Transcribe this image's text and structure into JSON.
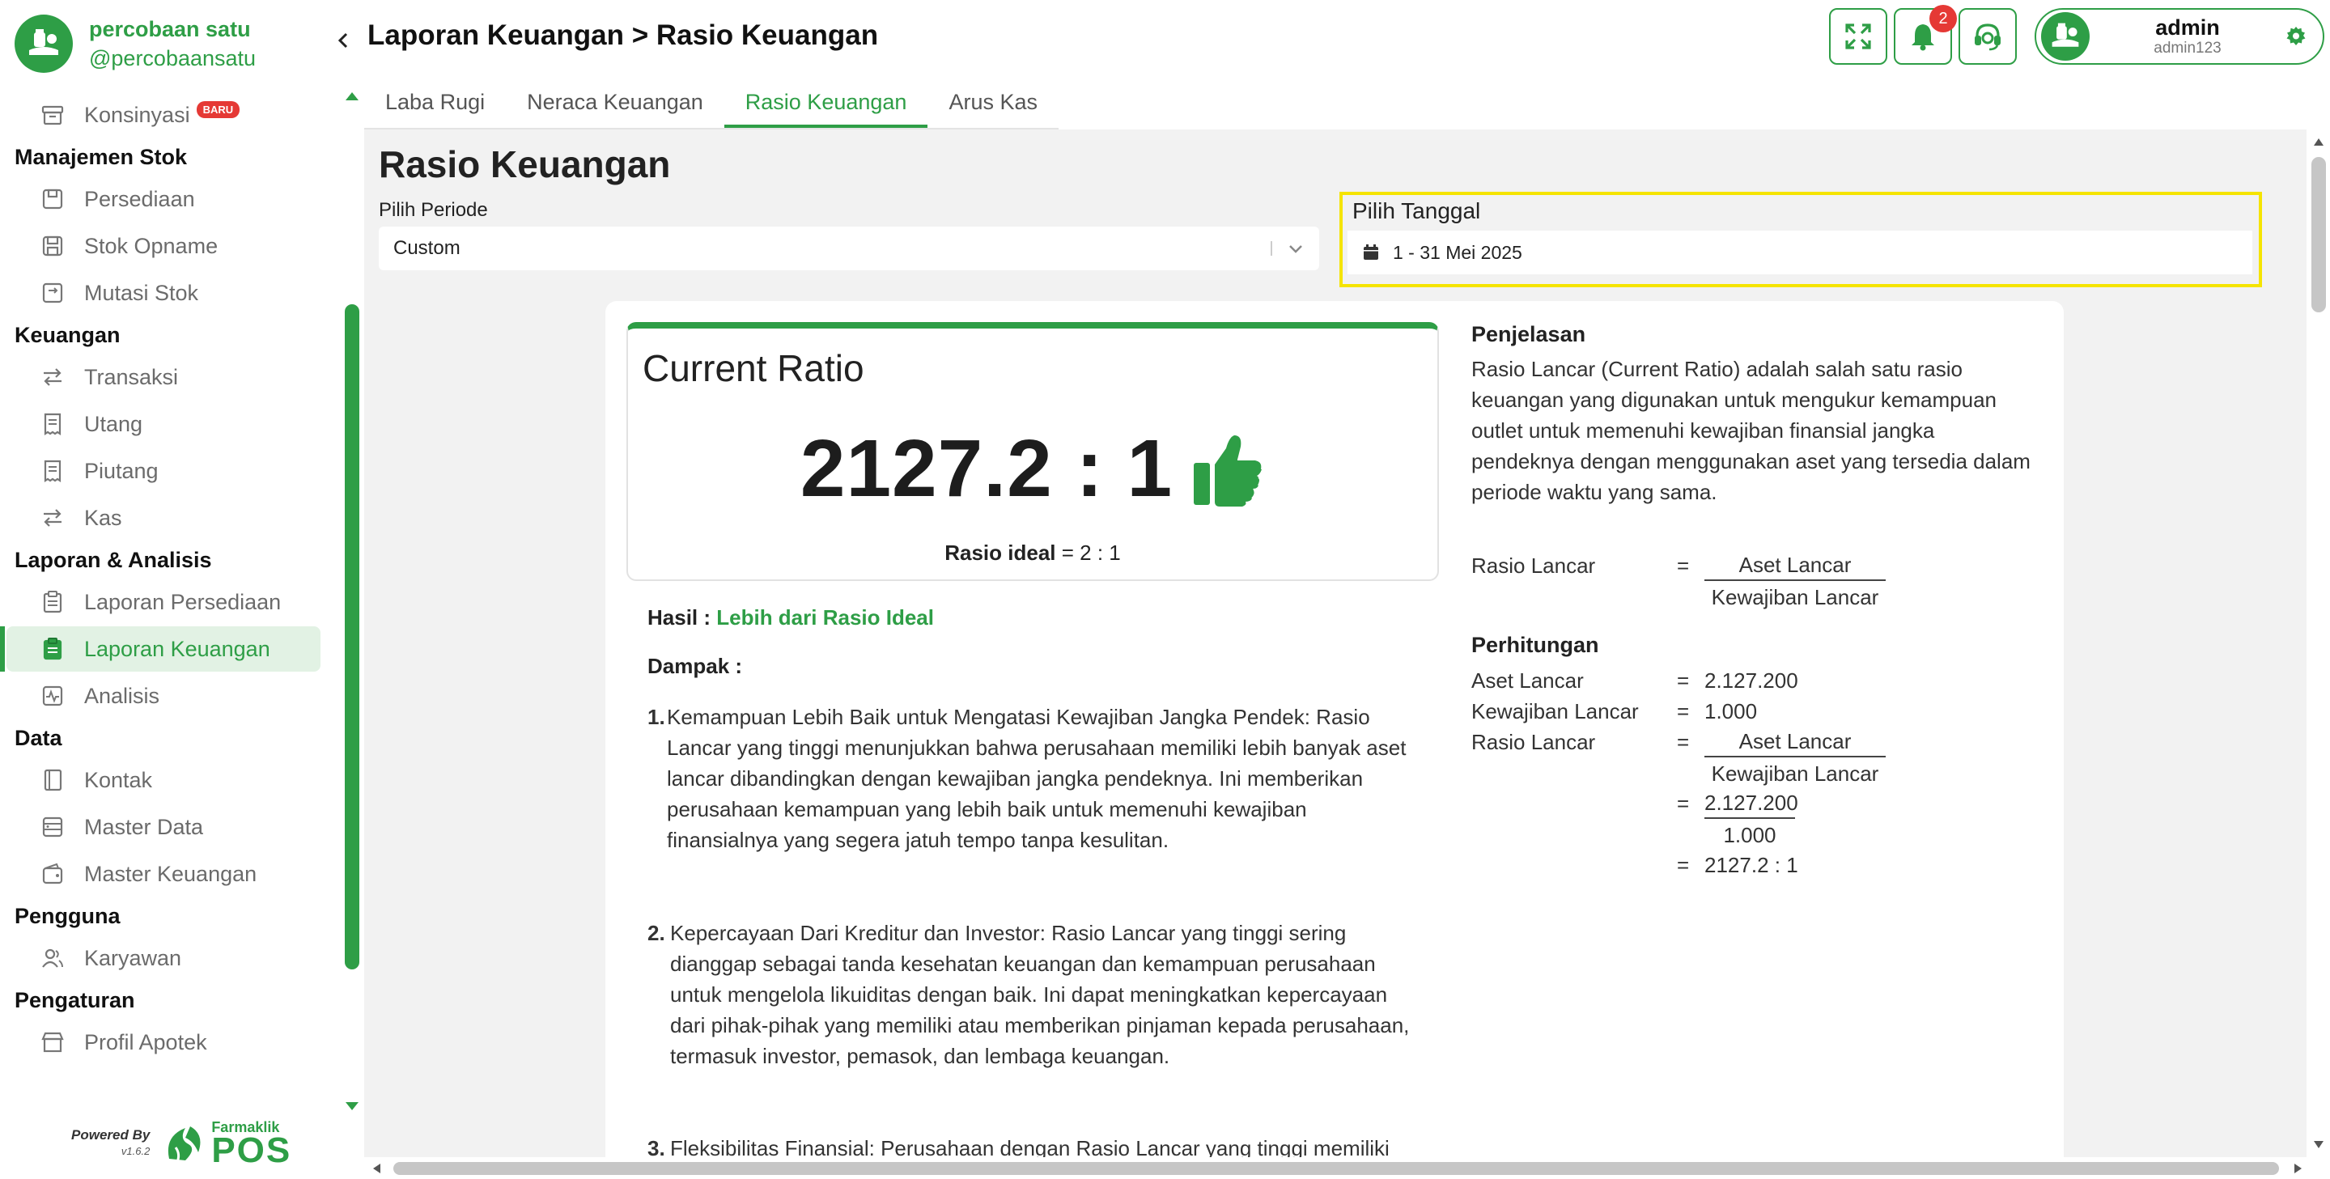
{
  "brand": {
    "name": "percobaan satu",
    "handle": "@percobaansatu"
  },
  "sidebar": {
    "top_item": {
      "label": "Konsinyasi",
      "badge": "BARU"
    },
    "groups": [
      {
        "title": "Manajemen Stok",
        "items": [
          {
            "label": "Persediaan",
            "icon": "box-icon"
          },
          {
            "label": "Stok Opname",
            "icon": "save-icon"
          },
          {
            "label": "Mutasi Stok",
            "icon": "transfer-box-icon"
          }
        ]
      },
      {
        "title": "Keuangan",
        "items": [
          {
            "label": "Transaksi",
            "icon": "exchange-icon"
          },
          {
            "label": "Utang",
            "icon": "receipt-icon"
          },
          {
            "label": "Piutang",
            "icon": "receipt-icon"
          },
          {
            "label": "Kas",
            "icon": "exchange-icon"
          }
        ]
      },
      {
        "title": "Laporan & Analisis",
        "items": [
          {
            "label": "Laporan Persediaan",
            "icon": "clipboard-icon"
          },
          {
            "label": "Laporan Keuangan",
            "icon": "clipboard-icon",
            "active": true
          },
          {
            "label": "Analisis",
            "icon": "activity-icon"
          }
        ]
      },
      {
        "title": "Data",
        "items": [
          {
            "label": "Kontak",
            "icon": "contact-book-icon"
          },
          {
            "label": "Master Data",
            "icon": "database-icon"
          },
          {
            "label": "Master Keuangan",
            "icon": "wallet-icon"
          }
        ]
      },
      {
        "title": "Pengguna",
        "items": [
          {
            "label": "Karyawan",
            "icon": "users-icon"
          }
        ]
      },
      {
        "title": "Pengaturan",
        "items": [
          {
            "label": "Profil Apotek",
            "icon": "store-icon"
          }
        ]
      }
    ],
    "powered_by": "Powered By",
    "version": "v1.6.2",
    "pos_brand_small": "Farmaklik",
    "pos_brand_big": "POS"
  },
  "header": {
    "breadcrumb": "Laporan Keuangan > Rasio Keuangan",
    "notification_count": "2",
    "user": {
      "name": "admin",
      "username": "admin123"
    }
  },
  "tabs": [
    {
      "label": "Laba Rugi"
    },
    {
      "label": "Neraca Keuangan"
    },
    {
      "label": "Rasio Keuangan",
      "active": true
    },
    {
      "label": "Arus Kas"
    }
  ],
  "main": {
    "title": "Rasio Keuangan",
    "period_label": "Pilih Periode",
    "period_value": "Custom",
    "date_label": "Pilih Tanggal",
    "date_value": "1 - 31 Mei 2025"
  },
  "ratio": {
    "title": "Current Ratio",
    "value": "2127.2 : 1",
    "ideal_label": "Rasio ideal",
    "ideal_value": " = 2 : 1",
    "result_label": "Hasil : ",
    "result_value": "Lebih dari Rasio Ideal",
    "impact_title": "Dampak :",
    "impacts": [
      {
        "num": "1.",
        "text": "Kemampuan Lebih Baik untuk Mengatasi Kewajiban Jangka Pendek: Rasio Lancar yang tinggi menunjukkan bahwa perusahaan memiliki lebih banyak aset lancar dibandingkan dengan kewajiban jangka pendeknya. Ini memberikan perusahaan kemampuan yang lebih baik untuk memenuhi kewajiban finansialnya yang segera jatuh tempo tanpa kesulitan."
      },
      {
        "num": "2.",
        "text": "Kepercayaan Dari Kreditur dan Investor: Rasio Lancar yang tinggi sering dianggap sebagai tanda kesehatan keuangan dan kemampuan perusahaan untuk mengelola likuiditas dengan baik. Ini dapat meningkatkan kepercayaan dari pihak-pihak yang memiliki atau memberikan pinjaman kepada perusahaan, termasuk investor, pemasok, dan lembaga keuangan."
      },
      {
        "num": "3.",
        "text": "Fleksibilitas Finansial: Perusahaan dengan Rasio Lancar yang tinggi memiliki fleksibilitas finansial yang lebih besar untuk mengambil peluang"
      }
    ]
  },
  "explanation": {
    "title": "Penjelasan",
    "text": "Rasio Lancar (Current Ratio) adalah salah satu rasio keuangan yang digunakan untuk mengukur kemampuan outlet untuk memenuhi kewajiban finansial jangka pendeknya dengan menggunakan aset yang tersedia dalam periode waktu yang sama.",
    "formula_left": "Rasio Lancar",
    "eq": "=",
    "formula_num": "Aset Lancar",
    "formula_den": "Kewajiban Lancar"
  },
  "calculation": {
    "title": "Perhitungan",
    "aset_label": "Aset Lancar",
    "aset_value": "2.127.200",
    "kewajiban_label": "Kewajiban Lancar",
    "kewajiban_value": "1.000",
    "ratio_label": "Rasio Lancar",
    "frac_num": "Aset Lancar",
    "frac_den": "Kewajiban Lancar",
    "num_value": "2.127.200",
    "den_value": "1.000",
    "result": "2127.2 : 1"
  },
  "colors": {
    "primary": "#2e9e46",
    "badge": "#e53935",
    "highlight": "#f5e400"
  }
}
